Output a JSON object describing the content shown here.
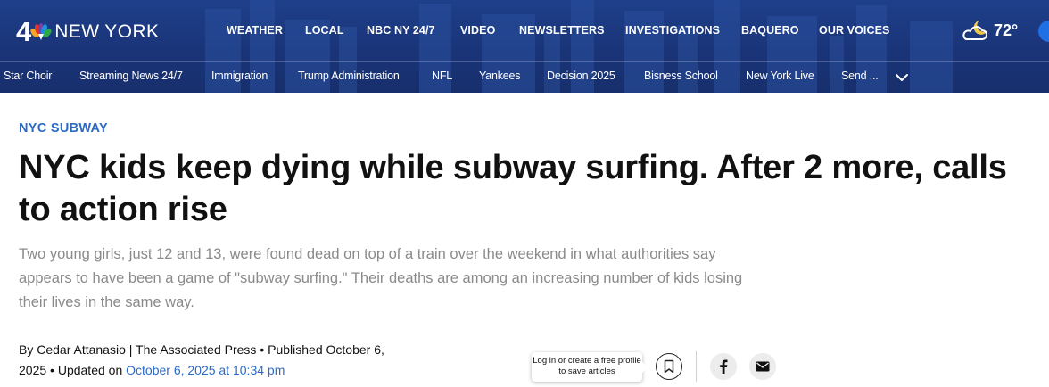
{
  "header": {
    "logo": {
      "number": "4",
      "brand_text": "NEW YORK"
    },
    "main_nav": [
      {
        "label": "WEATHER"
      },
      {
        "label": "LOCAL"
      },
      {
        "label": "NBC NY 24/7"
      },
      {
        "label": "VIDEO"
      },
      {
        "label": "NEWSLETTERS"
      },
      {
        "label": "INVESTIGATIONS"
      },
      {
        "label": "BAQUERO"
      },
      {
        "label": "OUR VOICES"
      }
    ],
    "weather": {
      "temperature": "72°",
      "icon": "partly-cloudy-night-icon"
    },
    "sub_nav": [
      {
        "label": "Star Choir"
      },
      {
        "label": "Streaming News 24/7"
      },
      {
        "label": "Immigration"
      },
      {
        "label": "Trump Administration"
      },
      {
        "label": "NFL"
      },
      {
        "label": "Yankees"
      },
      {
        "label": "Decision 2025"
      },
      {
        "label": "Bisness School"
      },
      {
        "label": "New York Live"
      },
      {
        "label": "Send ..."
      }
    ],
    "sub_nav_more_icon": "chevron-down-icon"
  },
  "article": {
    "category": "NYC SUBWAY",
    "headline": "NYC kids keep dying while subway surfing. After 2 more, calls to action rise",
    "dek": "Two young girls, just 12 and 13, were found dead on top of a train over the weekend in what authorities say appears to have been a game of \"subway surfing.\" Their deaths are among an increasing number of kids losing their lives in the same way.",
    "byline": {
      "prefix": "By",
      "author": "Cedar Attanasio",
      "separator": "|",
      "outlet": "The Associated Press",
      "published_label": "• Published",
      "published_date": "October 6, 2025",
      "updated_label": "• Updated on",
      "updated_date": "October 6, 2025 at 10:34 pm"
    },
    "save_tooltip": "Log in or create a free profile to save articles",
    "actions": {
      "bookmark_icon": "bookmark-icon",
      "facebook_icon": "facebook-icon",
      "email_icon": "email-icon"
    }
  },
  "colors": {
    "header_blue": "#1a3478",
    "link_blue": "#2b6bc7",
    "headline": "#111111",
    "dek_gray": "#8a8a8a"
  }
}
